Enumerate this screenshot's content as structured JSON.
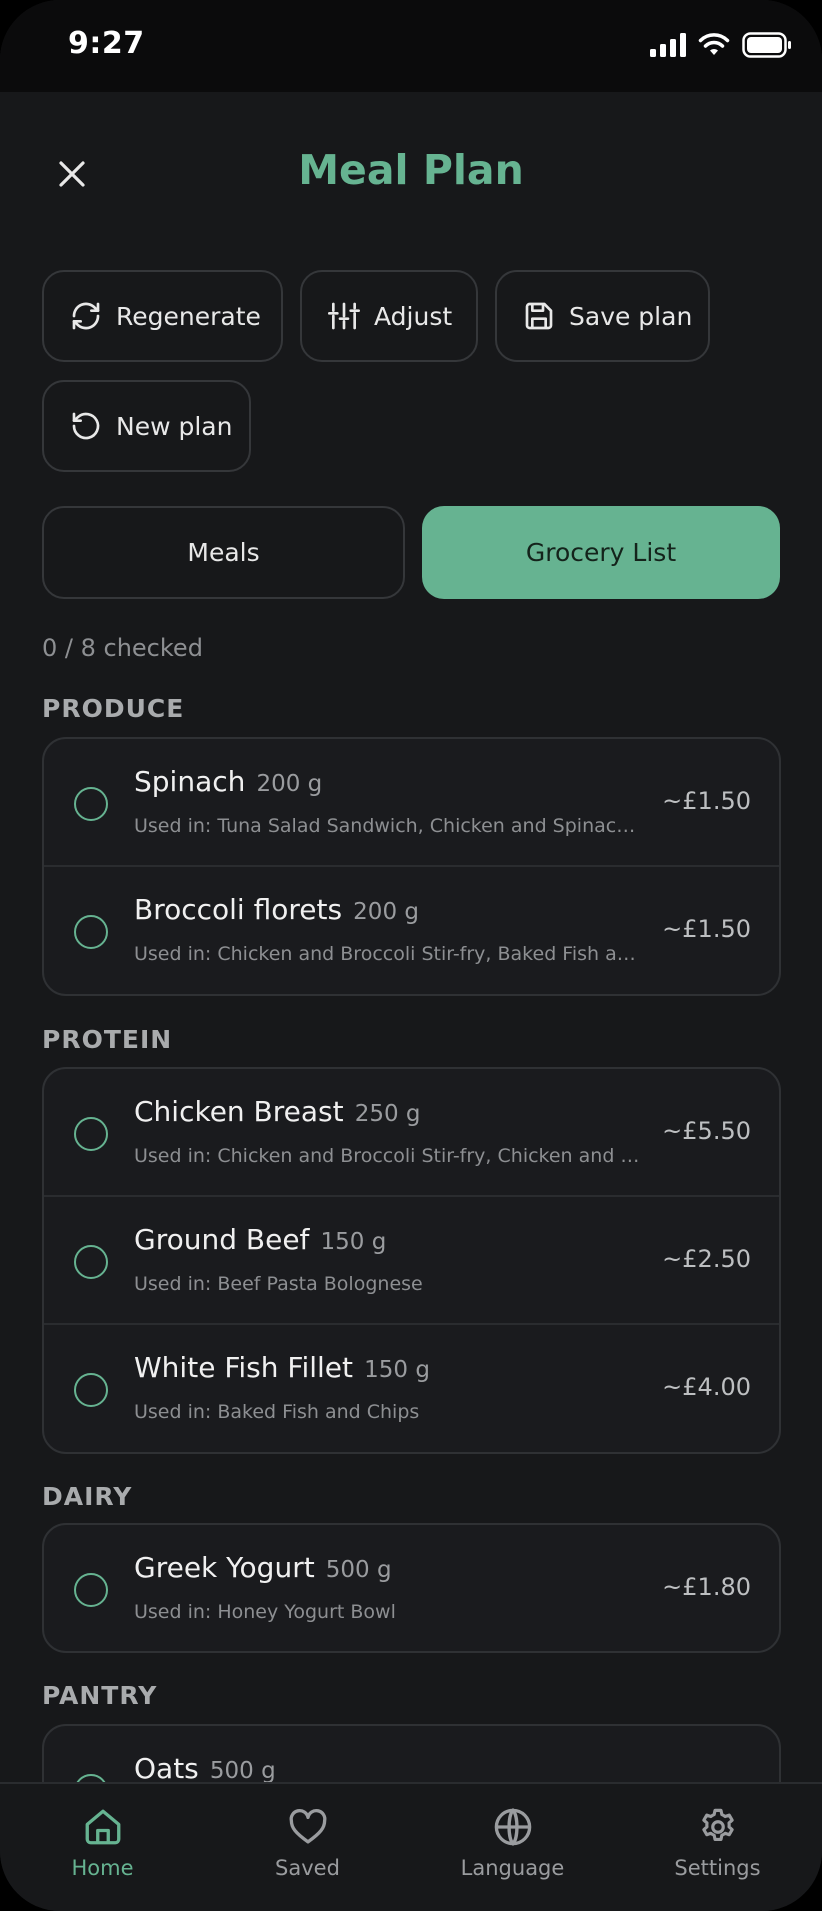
{
  "status": {
    "time": "9:27"
  },
  "header": {
    "title": "Meal Plan"
  },
  "actions": {
    "regenerate": "Regenerate",
    "adjust": "Adjust",
    "save_plan": "Save plan",
    "new_plan": "New plan"
  },
  "tabs": {
    "meals": "Meals",
    "grocery": "Grocery List"
  },
  "checked_summary": "0 / 8 checked",
  "categories": [
    {
      "name": "PRODUCE",
      "items": [
        {
          "name": "Spinach",
          "qty": "200 g",
          "used": "Used in: Tuna Salad Sandwich, Chicken and Spinac…",
          "price": "~£1.50"
        },
        {
          "name": "Broccoli florets",
          "qty": "200 g",
          "used": "Used in: Chicken and Broccoli Stir-fry, Baked Fish an…",
          "price": "~£1.50"
        }
      ]
    },
    {
      "name": "PROTEIN",
      "items": [
        {
          "name": "Chicken Breast",
          "qty": "250 g",
          "used": "Used in: Chicken and Broccoli Stir-fry, Chicken and …",
          "price": "~£5.50"
        },
        {
          "name": "Ground Beef",
          "qty": "150 g",
          "used": "Used in: Beef Pasta Bolognese",
          "price": "~£2.50"
        },
        {
          "name": "White Fish Fillet",
          "qty": "150 g",
          "used": "Used in: Baked Fish and Chips",
          "price": "~£4.00"
        }
      ]
    },
    {
      "name": "DAIRY",
      "items": [
        {
          "name": "Greek Yogurt",
          "qty": "500 g",
          "used": "Used in: Honey Yogurt Bowl",
          "price": "~£1.80"
        }
      ]
    },
    {
      "name": "PANTRY",
      "items": [
        {
          "name": "Oats",
          "qty": "500 g",
          "used": "",
          "price": ""
        }
      ]
    }
  ],
  "nav": {
    "home": "Home",
    "saved": "Saved",
    "language": "Language",
    "settings": "Settings"
  },
  "colors": {
    "accent": "#66b391",
    "background": "#17181a"
  }
}
